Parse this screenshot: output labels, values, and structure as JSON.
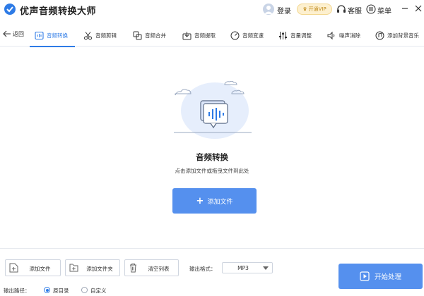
{
  "app": {
    "title": "优声音频转换大师"
  },
  "header": {
    "login_label": "登录",
    "vip_label": "开通VIP",
    "service_label": "客服",
    "menu_label": "菜单"
  },
  "toolbar": {
    "back_label": "返回",
    "tabs": [
      {
        "label": "音频转换",
        "icon": "audio-convert-icon",
        "active": true
      },
      {
        "label": "音频剪辑",
        "icon": "scissors-icon",
        "active": false
      },
      {
        "label": "音频合并",
        "icon": "merge-icon",
        "active": false
      },
      {
        "label": "音频提取",
        "icon": "extract-icon",
        "active": false
      },
      {
        "label": "音频变速",
        "icon": "speed-icon",
        "active": false
      },
      {
        "label": "音量调整",
        "icon": "equalizer-icon",
        "active": false
      },
      {
        "label": "噪声消除",
        "icon": "noise-icon",
        "active": false
      },
      {
        "label": "添加背景音乐",
        "icon": "music-add-icon",
        "active": false
      }
    ],
    "accent_color": "#2e7be6"
  },
  "main": {
    "title": "音频转换",
    "subtitle": "点击添加文件或拖曳文件到此处",
    "add_file_label": "添加文件"
  },
  "bottom": {
    "add_file_label": "添加文件",
    "add_folder_label": "添加文件夹",
    "clear_list_label": "清空列表",
    "format_label": "输出格式：",
    "format_value": "MP3",
    "start_label": "开始处理",
    "path_label": "输出路径：",
    "path_options": [
      {
        "label": "原目录",
        "checked": true
      },
      {
        "label": "自定义",
        "checked": false
      }
    ],
    "button_color": "#5590ee"
  }
}
